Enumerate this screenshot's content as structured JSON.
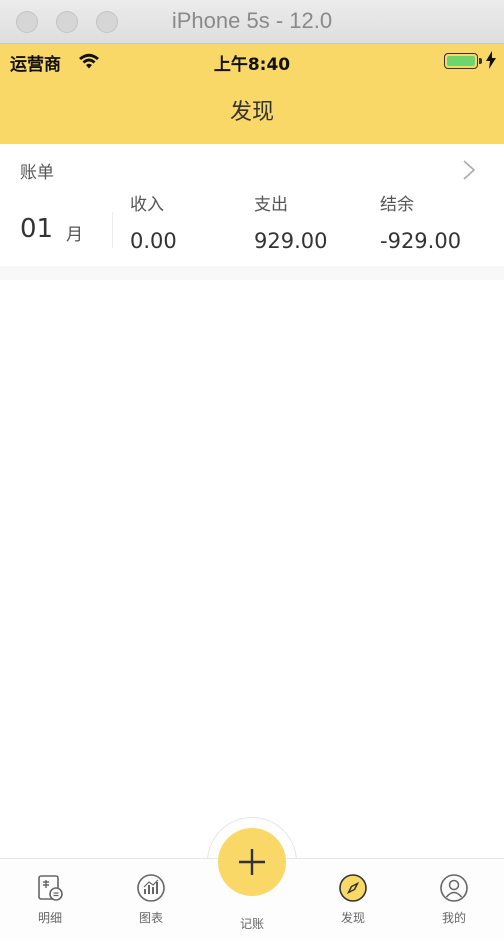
{
  "window": {
    "title": "iPhone 5s - 12.0"
  },
  "status_bar": {
    "carrier": "运营商",
    "time": "上午8:40"
  },
  "nav": {
    "title": "发现"
  },
  "bill": {
    "title": "账单",
    "month": "01",
    "month_unit": "月",
    "income_label": "收入",
    "income_value": "0.00",
    "expense_label": "支出",
    "expense_value": "929.00",
    "balance_label": "结余",
    "balance_value": "-929.00"
  },
  "tabbar": {
    "items": [
      {
        "label": "明细",
        "icon": "ledger-icon"
      },
      {
        "label": "图表",
        "icon": "chart-icon"
      },
      {
        "label": "记账",
        "icon": "plus-icon"
      },
      {
        "label": "发现",
        "icon": "compass-icon"
      },
      {
        "label": "我的",
        "icon": "profile-icon"
      }
    ]
  },
  "colors": {
    "accent": "#f9d867",
    "battery": "#6cd66c"
  }
}
